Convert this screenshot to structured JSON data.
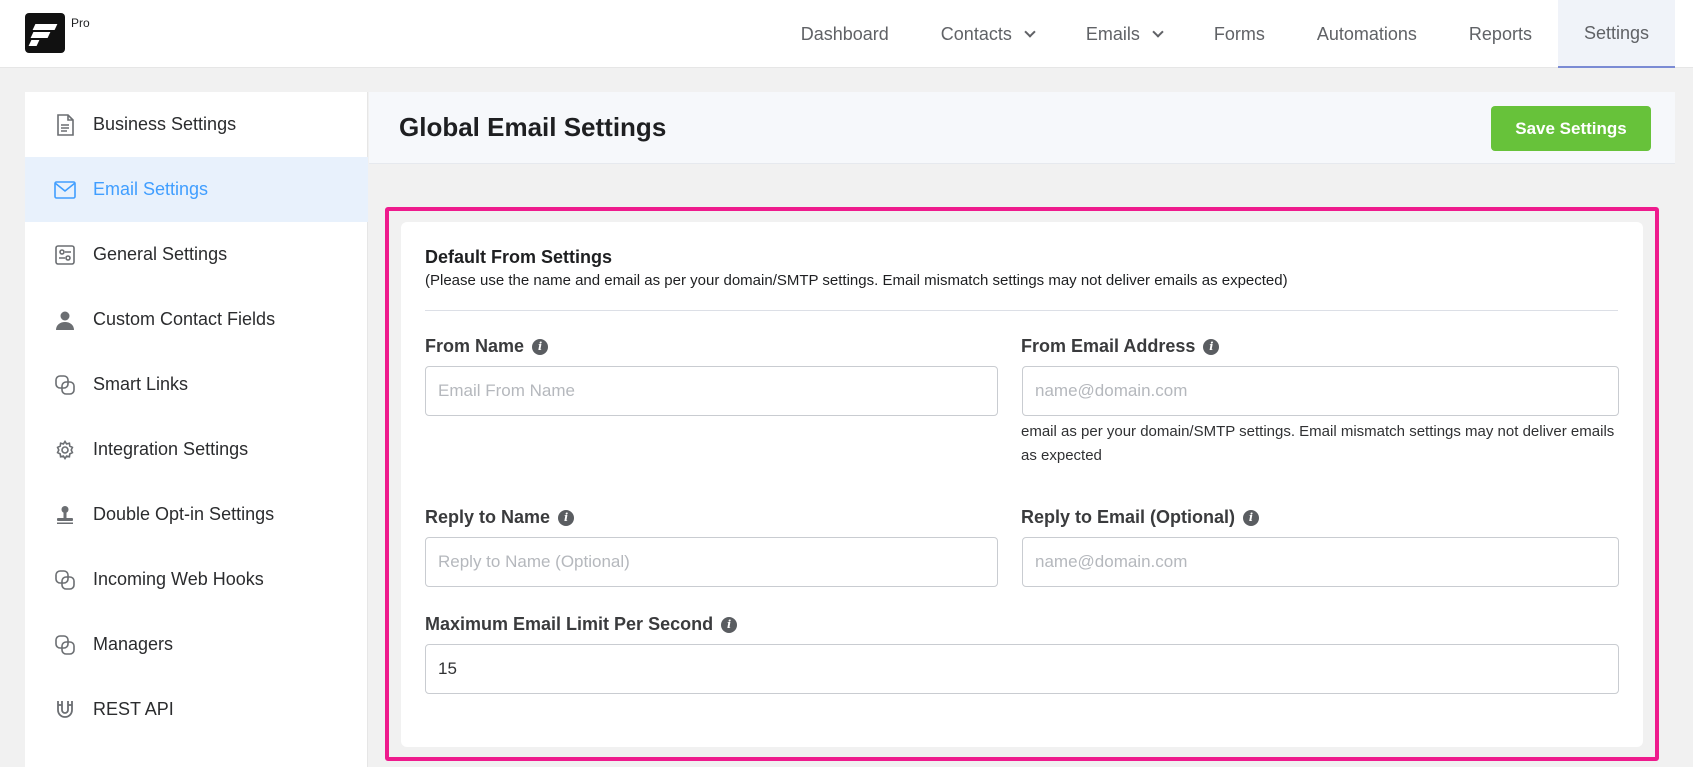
{
  "brand": {
    "badge": "Pro"
  },
  "nav": {
    "items": [
      {
        "label": "Dashboard",
        "dropdown": false,
        "active": false
      },
      {
        "label": "Contacts",
        "dropdown": true,
        "active": false
      },
      {
        "label": "Emails",
        "dropdown": true,
        "active": false
      },
      {
        "label": "Forms",
        "dropdown": false,
        "active": false
      },
      {
        "label": "Automations",
        "dropdown": false,
        "active": false
      },
      {
        "label": "Reports",
        "dropdown": false,
        "active": false
      },
      {
        "label": "Settings",
        "dropdown": false,
        "active": true
      }
    ]
  },
  "sidebar": {
    "items": [
      {
        "label": "Business Settings",
        "icon": "document-icon",
        "active": false
      },
      {
        "label": "Email Settings",
        "icon": "envelope-icon",
        "active": true
      },
      {
        "label": "General Settings",
        "icon": "sliders-icon",
        "active": false
      },
      {
        "label": "Custom Contact Fields",
        "icon": "user-icon",
        "active": false
      },
      {
        "label": "Smart Links",
        "icon": "link-icon",
        "active": false
      },
      {
        "label": "Integration Settings",
        "icon": "gear-icon",
        "active": false
      },
      {
        "label": "Double Opt-in Settings",
        "icon": "stamp-icon",
        "active": false
      },
      {
        "label": "Incoming Web Hooks",
        "icon": "link-icon",
        "active": false
      },
      {
        "label": "Managers",
        "icon": "link-icon",
        "active": false
      },
      {
        "label": "REST API",
        "icon": "magnet-icon",
        "active": false
      }
    ]
  },
  "main": {
    "title": "Global Email Settings",
    "save_label": "Save Settings"
  },
  "form": {
    "section_title": "Default From Settings",
    "section_subtitle": "(Please use the name and email as per your domain/SMTP settings. Email mismatch settings may not deliver emails as expected)",
    "from_name": {
      "label": "From Name",
      "placeholder": "Email From Name",
      "value": ""
    },
    "from_email": {
      "label": "From Email Address",
      "placeholder": "name@domain.com",
      "value": "",
      "help": "email as per your domain/SMTP settings. Email mismatch settings may not deliver emails as expected"
    },
    "reply_name": {
      "label": "Reply to Name",
      "placeholder": "Reply to Name (Optional)",
      "value": ""
    },
    "reply_email": {
      "label": "Reply to Email (Optional)",
      "placeholder": "name@domain.com",
      "value": ""
    },
    "max_limit": {
      "label": "Maximum Email Limit Per Second",
      "placeholder": "",
      "value": "15"
    }
  },
  "colors": {
    "accent_blue": "#409eff",
    "save_green": "#67c23a",
    "highlight_pink": "#ee1b8d"
  }
}
